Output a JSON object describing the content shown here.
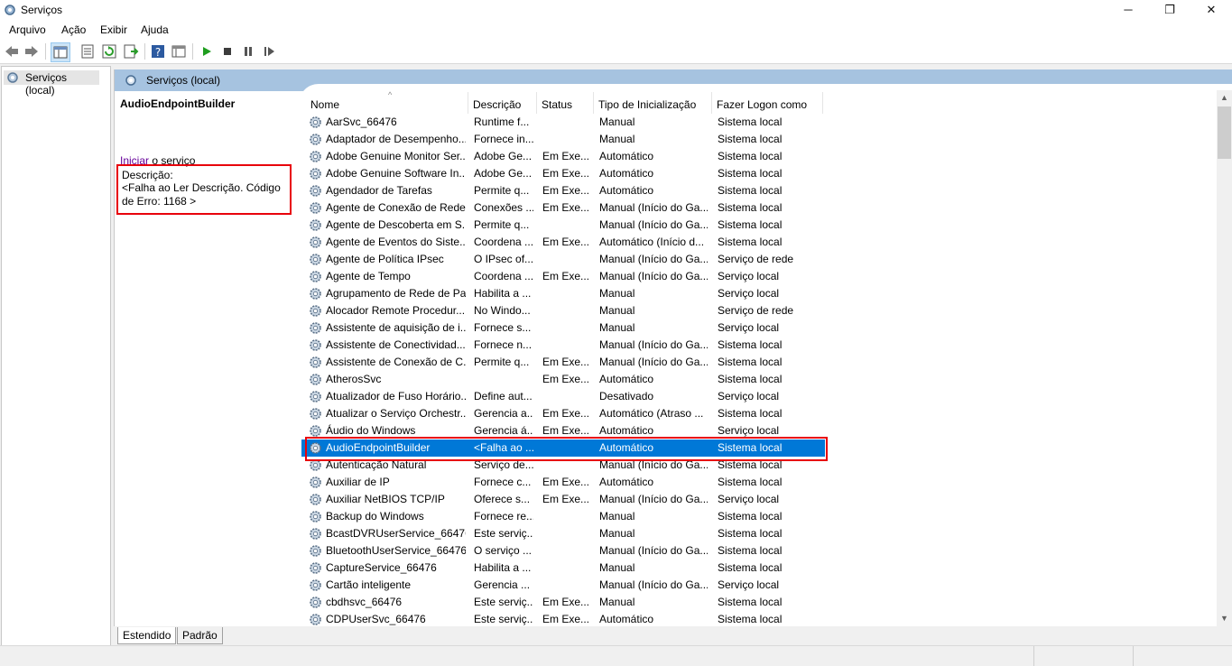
{
  "window": {
    "title": "Serviços",
    "controls": {
      "minimize": "─",
      "maximize": "❐",
      "close": "✕"
    }
  },
  "menu": [
    "Arquivo",
    "Ação",
    "Exibir",
    "Ajuda"
  ],
  "toolbar_icons": [
    "back-icon",
    "forward-icon",
    "show-hide-tree-icon",
    "properties-icon",
    "refresh-icon",
    "export-list-icon",
    "help-icon",
    "toggle-view-icon",
    "start-icon",
    "stop-icon",
    "pause-icon",
    "resume-icon"
  ],
  "tree": {
    "root_label": "Serviços (local)"
  },
  "pane": {
    "header": "Serviços (local)"
  },
  "details": {
    "service_name": "AudioEndpointBuilder",
    "action_link": "Iniciar",
    "action_suffix": " o serviço",
    "description_label": "Descrição:",
    "description_text": "<Falha ao Ler Descrição. Código de Erro: 1168 >"
  },
  "columns": [
    "Nome",
    "Descrição",
    "Status",
    "Tipo de Inicialização",
    "Fazer Logon como"
  ],
  "rows": [
    {
      "name": "AarSvc_66476",
      "desc": "Runtime f...",
      "status": "",
      "startup": "Manual",
      "logon": "Sistema local"
    },
    {
      "name": "Adaptador de Desempenho...",
      "desc": "Fornece in...",
      "status": "",
      "startup": "Manual",
      "logon": "Sistema local"
    },
    {
      "name": "Adobe Genuine Monitor Ser...",
      "desc": "Adobe Ge...",
      "status": "Em Exe...",
      "startup": "Automático",
      "logon": "Sistema local"
    },
    {
      "name": "Adobe Genuine Software In...",
      "desc": "Adobe Ge...",
      "status": "Em Exe...",
      "startup": "Automático",
      "logon": "Sistema local"
    },
    {
      "name": "Agendador de Tarefas",
      "desc": "Permite q...",
      "status": "Em Exe...",
      "startup": "Automático",
      "logon": "Sistema local"
    },
    {
      "name": "Agente de Conexão de Rede",
      "desc": "Conexões ...",
      "status": "Em Exe...",
      "startup": "Manual (Início do Ga...",
      "logon": "Sistema local"
    },
    {
      "name": "Agente de Descoberta em S...",
      "desc": "Permite q...",
      "status": "",
      "startup": "Manual (Início do Ga...",
      "logon": "Sistema local"
    },
    {
      "name": "Agente de Eventos do Siste...",
      "desc": "Coordena ...",
      "status": "Em Exe...",
      "startup": "Automático (Início d...",
      "logon": "Sistema local"
    },
    {
      "name": "Agente de Política IPsec",
      "desc": "O IPsec of...",
      "status": "",
      "startup": "Manual (Início do Ga...",
      "logon": "Serviço de rede"
    },
    {
      "name": "Agente de Tempo",
      "desc": "Coordena ...",
      "status": "Em Exe...",
      "startup": "Manual (Início do Ga...",
      "logon": "Serviço local"
    },
    {
      "name": "Agrupamento de Rede de Par",
      "desc": "Habilita a ...",
      "status": "",
      "startup": "Manual",
      "logon": "Serviço local"
    },
    {
      "name": "Alocador Remote Procedur...",
      "desc": "No Windo...",
      "status": "",
      "startup": "Manual",
      "logon": "Serviço de rede"
    },
    {
      "name": "Assistente de aquisição de i...",
      "desc": "Fornece s...",
      "status": "",
      "startup": "Manual",
      "logon": "Serviço local"
    },
    {
      "name": "Assistente de Conectividad...",
      "desc": "Fornece n...",
      "status": "",
      "startup": "Manual (Início do Ga...",
      "logon": "Sistema local"
    },
    {
      "name": "Assistente de Conexão de C...",
      "desc": "Permite q...",
      "status": "Em Exe...",
      "startup": "Manual (Início do Ga...",
      "logon": "Sistema local"
    },
    {
      "name": "AtherosSvc",
      "desc": "",
      "status": "Em Exe...",
      "startup": "Automático",
      "logon": "Sistema local"
    },
    {
      "name": "Atualizador de Fuso Horário...",
      "desc": "Define aut...",
      "status": "",
      "startup": "Desativado",
      "logon": "Serviço local"
    },
    {
      "name": "Atualizar o Serviço Orchestr...",
      "desc": "Gerencia a...",
      "status": "Em Exe...",
      "startup": "Automático (Atraso ...",
      "logon": "Sistema local"
    },
    {
      "name": "Áudio do Windows",
      "desc": "Gerencia á...",
      "status": "Em Exe...",
      "startup": "Automático",
      "logon": "Serviço local"
    },
    {
      "name": "AudioEndpointBuilder",
      "desc": "<Falha ao ...",
      "status": "",
      "startup": "Automático",
      "logon": "Sistema local",
      "selected": true
    },
    {
      "name": "Autenticação Natural",
      "desc": "Serviço de...",
      "status": "",
      "startup": "Manual (Início do Ga...",
      "logon": "Sistema local"
    },
    {
      "name": "Auxiliar de IP",
      "desc": "Fornece c...",
      "status": "Em Exe...",
      "startup": "Automático",
      "logon": "Sistema local"
    },
    {
      "name": "Auxiliar NetBIOS TCP/IP",
      "desc": "Oferece s...",
      "status": "Em Exe...",
      "startup": "Manual (Início do Ga...",
      "logon": "Serviço local"
    },
    {
      "name": "Backup do Windows",
      "desc": "Fornece re...",
      "status": "",
      "startup": "Manual",
      "logon": "Sistema local"
    },
    {
      "name": "BcastDVRUserService_66476",
      "desc": "Este serviç...",
      "status": "",
      "startup": "Manual",
      "logon": "Sistema local"
    },
    {
      "name": "BluetoothUserService_66476",
      "desc": "O serviço ...",
      "status": "",
      "startup": "Manual (Início do Ga...",
      "logon": "Sistema local"
    },
    {
      "name": "CaptureService_66476",
      "desc": "Habilita a ...",
      "status": "",
      "startup": "Manual",
      "logon": "Sistema local"
    },
    {
      "name": "Cartão inteligente",
      "desc": "Gerencia ...",
      "status": "",
      "startup": "Manual (Início do Ga...",
      "logon": "Serviço local"
    },
    {
      "name": "cbdhsvc_66476",
      "desc": "Este serviç...",
      "status": "Em Exe...",
      "startup": "Manual",
      "logon": "Sistema local"
    },
    {
      "name": "CDPUserSvc_66476",
      "desc": "Este serviç...",
      "status": "Em Exe...",
      "startup": "Automático",
      "logon": "Sistema local"
    }
  ],
  "tabs": [
    "Estendido",
    "Padrão"
  ],
  "colors": {
    "selection": "#0078d7",
    "highlight_outline": "#e8000b",
    "pane_header": "#a6c3e0"
  }
}
